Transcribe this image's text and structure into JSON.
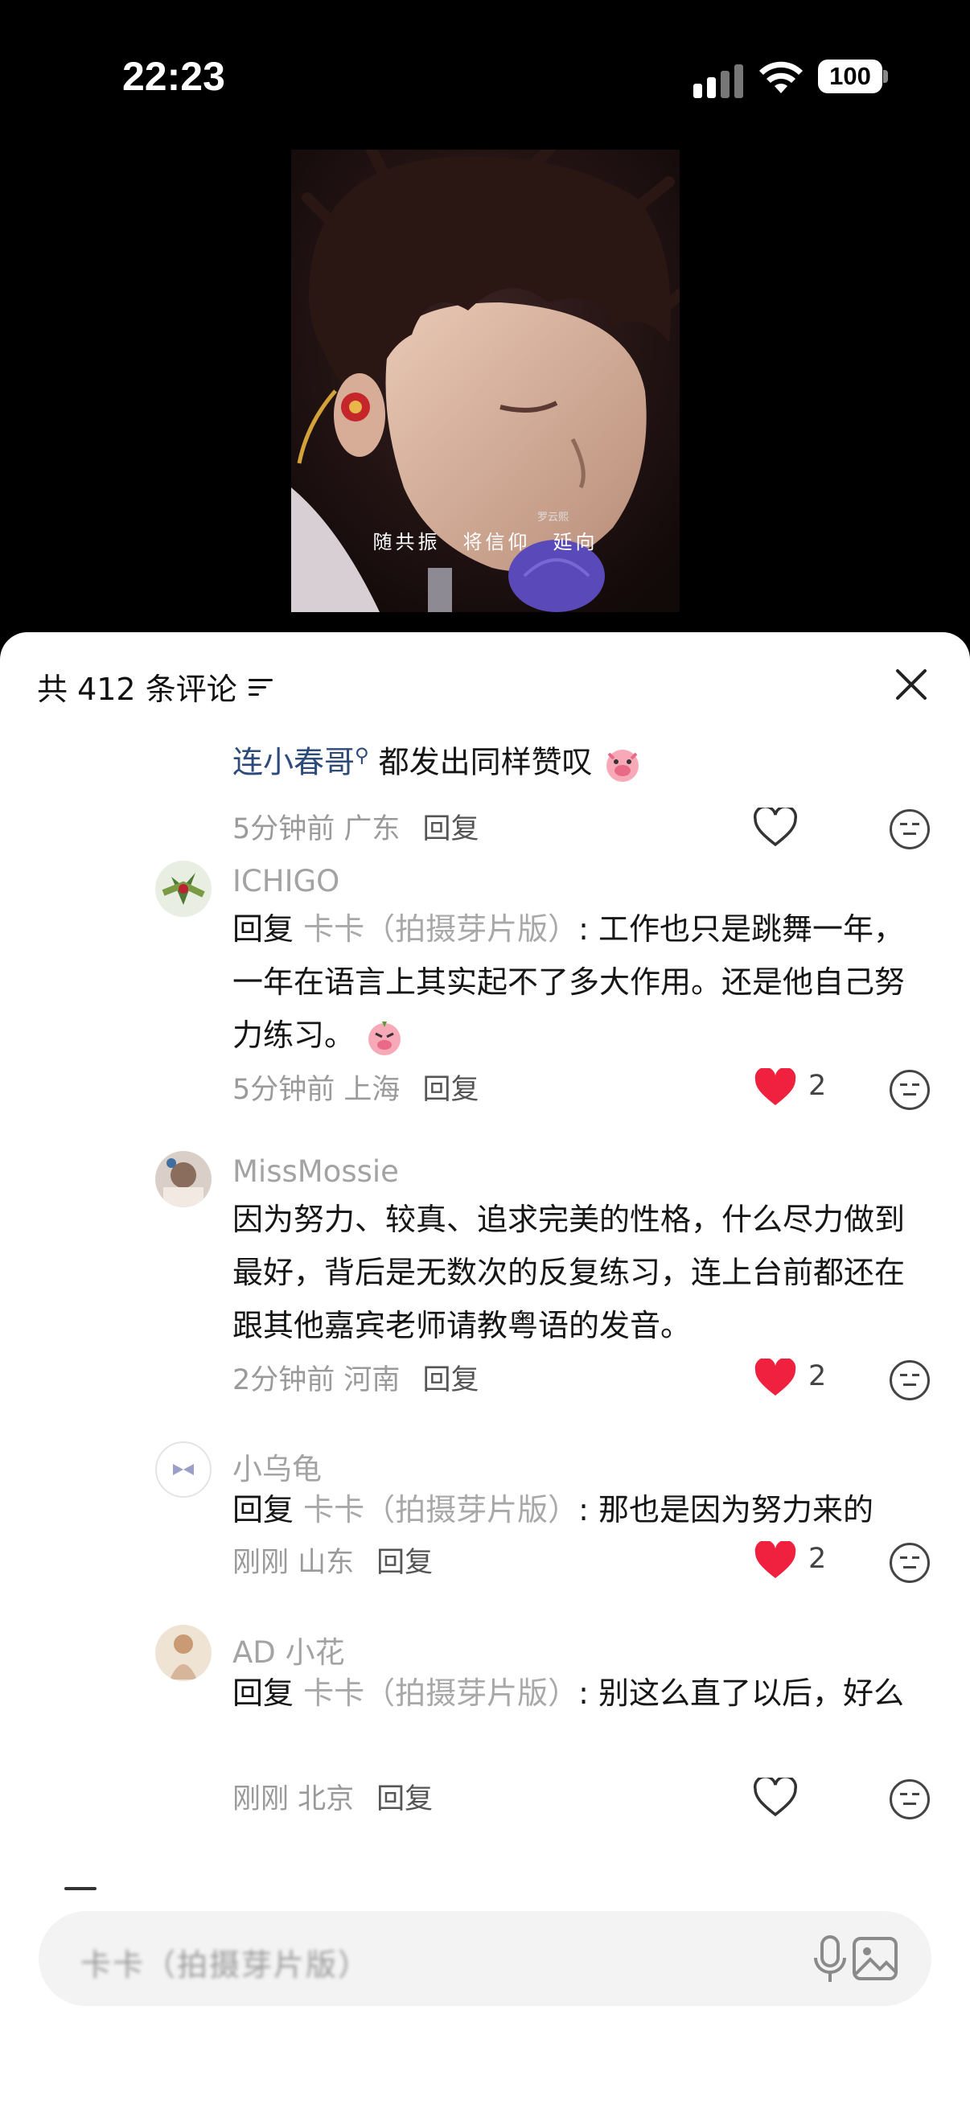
{
  "status_bar": {
    "time": "22:23",
    "battery": "100"
  },
  "video": {
    "subtitle": "随共振　将信仰　延向",
    "subtitle_small": "罗云熙"
  },
  "sheet": {
    "title": "共 412 条评论",
    "filter_icon": "filter-icon",
    "close_icon": "close-icon"
  },
  "comments": [
    {
      "id": "c0",
      "mention": "连小春哥",
      "text": " 都发出同样赞叹",
      "time": "5分钟前",
      "location": "广东",
      "reply": "回复",
      "liked": false,
      "likes": ""
    },
    {
      "id": "c1",
      "user": "ICHIGO",
      "reply_prefix": "回复",
      "reply_to": "卡卡（拍摄芽片版）",
      "text": ": 工作也只是跳舞一年，一年在语言上其实起不了多大作用。还是他自己努力练习。",
      "time": "5分钟前",
      "location": "上海",
      "reply": "回复",
      "liked": true,
      "likes": "2"
    },
    {
      "id": "c2",
      "user": "MissMossie",
      "text": "因为努力、较真、追求完美的性格，什么尽力做到最好，背后是无数次的反复练习，连上台前都还在跟其他嘉宾老师请教粤语的发音。",
      "time": "2分钟前",
      "location": "河南",
      "reply": "回复",
      "liked": true,
      "likes": "2"
    },
    {
      "id": "c3",
      "user": "小乌龟",
      "reply_prefix": "回复",
      "reply_to": "卡卡（拍摄芽片版）",
      "text": ": 那也是因为努力来的",
      "time": "刚刚",
      "location": "山东",
      "reply": "回复",
      "liked": true,
      "likes": "2"
    },
    {
      "id": "c4",
      "user": "AD 小花",
      "reply_prefix": "回复",
      "reply_to": "卡卡（拍摄芽片版）",
      "text": ": 别这么直了以后，好么",
      "time": "刚刚",
      "location": "北京",
      "reply": "回复",
      "liked": false,
      "likes": ""
    }
  ],
  "input": {
    "placeholder": "卡卡（拍摄芽片版）",
    "mic_icon": "microphone-icon",
    "image_icon": "image-icon"
  },
  "colors": {
    "like_red": "#f0213f",
    "mention_blue": "#2c4a7a",
    "muted": "#a8a8a8"
  }
}
